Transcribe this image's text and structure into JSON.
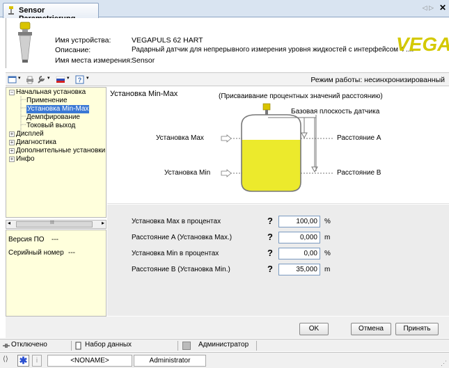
{
  "tab": {
    "title": "Sensor Parametrierung",
    "nav": "◁ ▷",
    "close": "✕"
  },
  "device": {
    "name_label": "Имя устройства:",
    "name_value": "VEGAPULS 62 HART",
    "desc_label": "Описание:",
    "desc_value": "Радарный датчик для непрерывного измерения уровня жидкостей с интерфейсом 4 ....",
    "loc_label": "Имя места измерения:",
    "loc_value": "Sensor",
    "logo": "VEGA"
  },
  "toolbar": {
    "mode": "Режим работы: несинхронизированный"
  },
  "tree": {
    "items": [
      {
        "label": "Начальная установка",
        "expander": "−"
      },
      {
        "label": "Применение"
      },
      {
        "label": "Установка Min-Max",
        "selected": true
      },
      {
        "label": "Демпфирование"
      },
      {
        "label": "Токовый выход"
      },
      {
        "label": "Дисплей",
        "expander": "+"
      },
      {
        "label": "Диагностика",
        "expander": "+"
      },
      {
        "label": "Дополнительные установки",
        "expander": "+"
      },
      {
        "label": "Инфо",
        "expander": "+"
      }
    ],
    "scroll_grip": "III"
  },
  "info": {
    "fw_label": "Версия ПО",
    "fw_value": "---",
    "serial_label": "Серийный номер",
    "serial_value": "---"
  },
  "diagram": {
    "title": "Установка Min-Max",
    "subtitle": "(Присваивание процентных значений расстоянию)",
    "ref_plane": "Базовая плоскость датчика",
    "max_label": "Установка Max",
    "min_label": "Установка Min",
    "dist_a": "Расстояние A",
    "dist_b": "Расстояние B"
  },
  "params": [
    {
      "label": "Установка Max в процентах",
      "value": "100,00",
      "unit": "%"
    },
    {
      "label": "Расстояние A (Установка Max.)",
      "value": "0,000",
      "unit": "m"
    },
    {
      "label": "Установка Min в процентах",
      "value": "0,00",
      "unit": "%"
    },
    {
      "label": "Расстояние B (Установка Min.)",
      "value": "35,000",
      "unit": "m"
    }
  ],
  "help_mark": "?",
  "buttons": {
    "ok": "OK",
    "cancel": "Отмена",
    "apply": "Принять"
  },
  "status": {
    "connection": "Отключено",
    "dataset": "Набор данных",
    "role": "Администратор",
    "project": "<NONAME>",
    "user": "Administrator"
  },
  "colors": {
    "tree_bg": "#ffffdc",
    "vega_yellow": "#d4c900",
    "liquid": "#ecea2c",
    "selection": "#3a78d4"
  }
}
